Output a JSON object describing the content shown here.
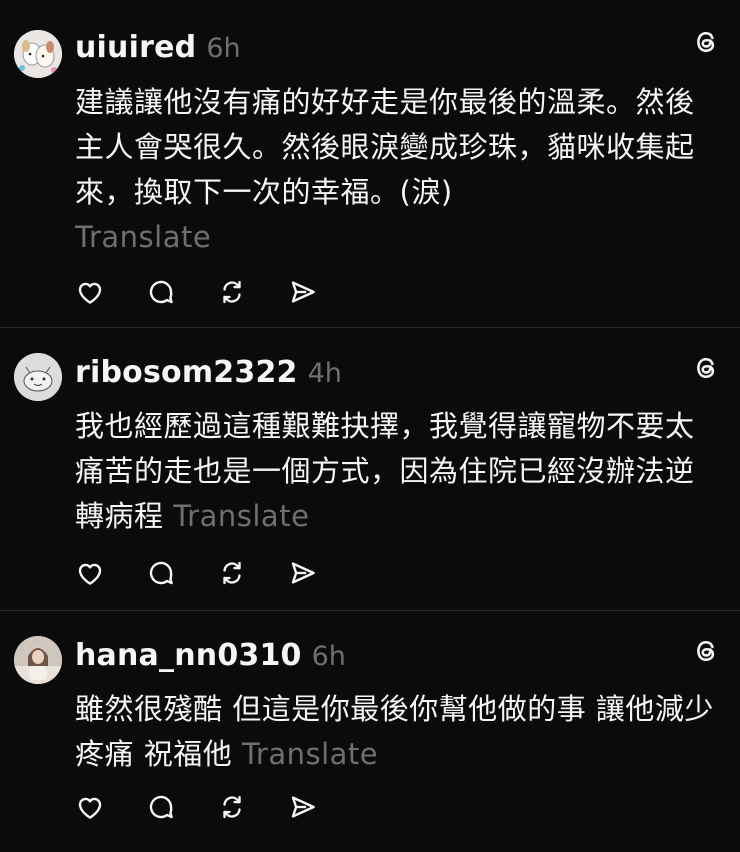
{
  "posts": [
    {
      "username": "uiuired",
      "time": "6h",
      "body": "建議讓他沒有痛的好好走是你最後的溫柔。然後主人會哭很久。然後眼淚變成珍珠，貓咪收集起來，換取下一次的幸福。(淚)",
      "translate": "Translate",
      "avatar": "avatar-cartoon-dog"
    },
    {
      "username": "ribosom2322",
      "time": "4h",
      "body": "我也經歷過這種艱難抉擇，我覺得讓寵物不要太痛苦的走也是一個方式，因為住院已經沒辦法逆轉病程",
      "translate": "Translate",
      "avatar": "avatar-sketch"
    },
    {
      "username": "hana_nn0310",
      "time": "6h",
      "body": "雖然很殘酷 但這是你最後你幫他做的事 讓他減少疼痛 祝福他",
      "translate": "Translate",
      "avatar": "avatar-photo"
    }
  ],
  "icons": [
    "heart-icon",
    "comment-icon",
    "repost-icon",
    "share-icon",
    "threads-icon"
  ],
  "colors": {
    "background": "#0b0b0b",
    "text": "#f3f5f7",
    "muted": "#6f6f6f",
    "divider": "#2a2a2a"
  }
}
